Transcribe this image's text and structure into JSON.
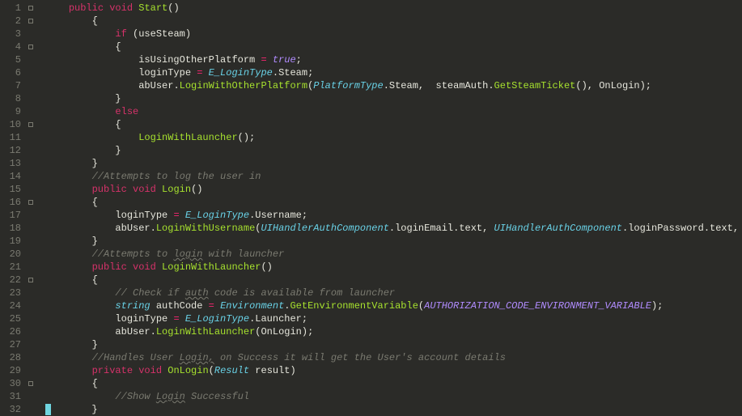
{
  "lines": [
    {
      "n": 1,
      "fold": "box",
      "html": "    <span class='kw'>public</span> <span class='kw'>void</span> <span class='fn'>Start</span><span class='punc'>()</span>"
    },
    {
      "n": 2,
      "fold": "box",
      "html": "        <span class='punc'>{</span>"
    },
    {
      "n": 3,
      "fold": "",
      "html": "            <span class='kw'>if</span> <span class='punc'>(</span><span class='prop'>useSteam</span><span class='punc'>)</span>"
    },
    {
      "n": 4,
      "fold": "box",
      "html": "            <span class='punc'>{</span>"
    },
    {
      "n": 5,
      "fold": "",
      "html": "                <span class='prop'>isUsingOtherPlatform</span> <span class='op'>=</span> <span class='bool'>true</span><span class='punc'>;</span>"
    },
    {
      "n": 6,
      "fold": "",
      "html": "                <span class='prop'>loginType</span> <span class='op'>=</span> <span class='type'>E_LoginType</span><span class='punc'>.</span><span class='prop'>Steam</span><span class='punc'>;</span>"
    },
    {
      "n": 7,
      "fold": "",
      "html": "                <span class='prop'>abUser</span><span class='punc'>.</span><span class='fn'>LoginWithOtherPlatform</span><span class='punc'>(</span><span class='type'>PlatformType</span><span class='punc'>.</span><span class='prop'>Steam</span><span class='punc'>,</span>  <span class='prop'>steamAuth</span><span class='punc'>.</span><span class='fn'>GetSteamTicket</span><span class='punc'>()</span><span class='punc'>,</span> <span class='prop'>OnLogin</span><span class='punc'>);</span>"
    },
    {
      "n": 8,
      "fold": "",
      "html": "            <span class='punc'>}</span>"
    },
    {
      "n": 9,
      "fold": "",
      "html": "            <span class='kw'>else</span>"
    },
    {
      "n": 10,
      "fold": "box",
      "html": "            <span class='punc'>{</span>"
    },
    {
      "n": 11,
      "fold": "",
      "html": "                <span class='fn'>LoginWithLauncher</span><span class='punc'>();</span>"
    },
    {
      "n": 12,
      "fold": "",
      "html": "            <span class='punc'>}</span>"
    },
    {
      "n": 13,
      "fold": "",
      "html": "        <span class='punc'>}</span>"
    },
    {
      "n": 14,
      "fold": "",
      "html": "        <span class='com'>//Attempts to log the user in</span>"
    },
    {
      "n": 15,
      "fold": "",
      "html": "        <span class='kw'>public</span> <span class='kw'>void</span> <span class='fn'>Login</span><span class='punc'>()</span>"
    },
    {
      "n": 16,
      "fold": "box",
      "html": "        <span class='punc'>{</span>"
    },
    {
      "n": 17,
      "fold": "",
      "html": "            <span class='prop'>loginType</span> <span class='op'>=</span> <span class='type'>E_LoginType</span><span class='punc'>.</span><span class='prop'>Username</span><span class='punc'>;</span>"
    },
    {
      "n": 18,
      "fold": "",
      "html": "            <span class='prop'>abUser</span><span class='punc'>.</span><span class='fn'>LoginWithUsername</span><span class='punc'>(</span><span class='type'>UIHandlerAuthComponent</span><span class='punc'>.</span><span class='prop'>loginEmail</span><span class='punc'>.</span><span class='prop'>text</span><span class='punc'>,</span> <span class='type'>UIHandlerAuthComponent</span><span class='punc'>.</span><span class='prop'>loginPassword</span><span class='punc'>.</span><span class='prop'>text</span><span class='punc'>,</span> <span class='prop'>OnLogin</span><span class='punc'>);</span>"
    },
    {
      "n": 19,
      "fold": "",
      "html": "        <span class='punc'>}</span>"
    },
    {
      "n": 20,
      "fold": "",
      "html": "        <span class='com'>//Attempts to <span class='wave'>login</span> with launcher</span>"
    },
    {
      "n": 21,
      "fold": "",
      "html": "        <span class='kw'>public</span> <span class='kw'>void</span> <span class='fn'>LoginWithLauncher</span><span class='punc'>()</span>"
    },
    {
      "n": 22,
      "fold": "box",
      "html": "        <span class='punc'>{</span>"
    },
    {
      "n": 23,
      "fold": "",
      "html": "            <span class='com'>// Check if <span class='wave'>auth</span> code is available from launcher</span>"
    },
    {
      "n": 24,
      "fold": "",
      "html": "            <span class='type'>string</span> <span class='prop'>authCode</span> <span class='op'>=</span> <span class='type'>Environment</span><span class='punc'>.</span><span class='fn'>GetEnvironmentVariable</span><span class='punc'>(</span><span class='const'>AUTHORIZATION_CODE_ENVIRONMENT_VARIABLE</span><span class='punc'>);</span>"
    },
    {
      "n": 25,
      "fold": "",
      "html": "            <span class='prop'>loginType</span> <span class='op'>=</span> <span class='type'>E_LoginType</span><span class='punc'>.</span><span class='prop'>Launcher</span><span class='punc'>;</span>"
    },
    {
      "n": 26,
      "fold": "",
      "html": "            <span class='prop'>abUser</span><span class='punc'>.</span><span class='fn'>LoginWithLauncher</span><span class='punc'>(</span><span class='prop'>OnLogin</span><span class='punc'>);</span>"
    },
    {
      "n": 27,
      "fold": "",
      "html": "        <span class='punc'>}</span>"
    },
    {
      "n": 28,
      "fold": "",
      "html": "        <span class='com'>//Handles User <span class='wave'>Login,</span> on Success it will get the User's account details</span>"
    },
    {
      "n": 29,
      "fold": "",
      "html": "        <span class='kw'>private</span> <span class='kw'>void</span> <span class='fn'>OnLogin</span><span class='punc'>(</span><span class='type'>Result</span> <span class='prop'>result</span><span class='punc'>)</span>"
    },
    {
      "n": 30,
      "fold": "box",
      "html": "        <span class='punc'>{</span>"
    },
    {
      "n": 31,
      "fold": "",
      "html": "            <span class='com'>//Show <span class='wave'>Login</span> Successful</span>"
    },
    {
      "n": 32,
      "fold": "",
      "html": "<span class='cursor'></span>       <span class='punc'>}</span>"
    }
  ]
}
